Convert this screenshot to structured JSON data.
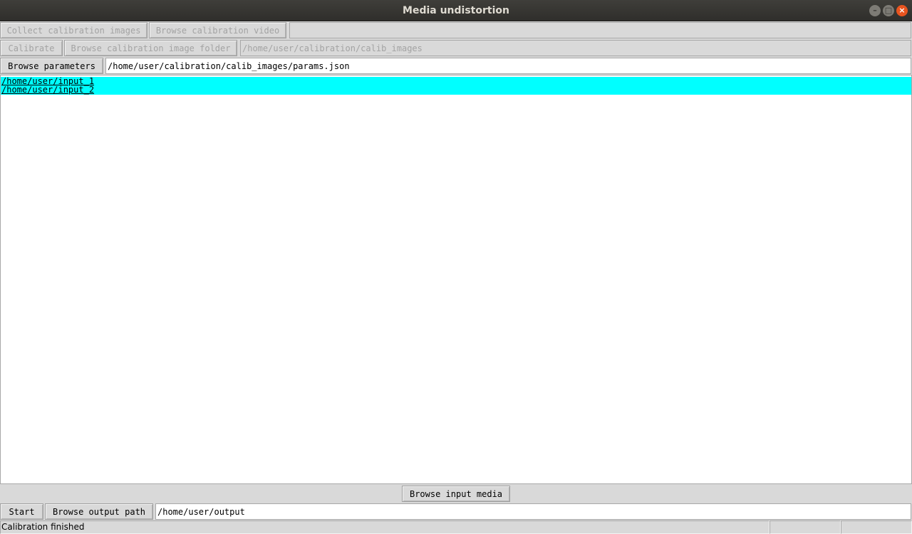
{
  "window": {
    "title": "Media undistortion",
    "minimize_glyph": "–",
    "maximize_glyph": "□",
    "close_glyph": "×"
  },
  "calibration": {
    "collect_images_label": "Collect calibration images",
    "browse_video_label": "Browse calibration video",
    "video_path_value": "",
    "calibrate_label": "Calibrate",
    "browse_image_folder_label": "Browse calibration image folder",
    "image_folder_value": "/home/user/calibration/calib_images"
  },
  "parameters": {
    "browse_label": "Browse parameters",
    "path_value": "/home/user/calibration/calib_images/params.json"
  },
  "input_media": {
    "items": [
      "/home/user/input_1",
      "/home/user/input_2"
    ],
    "browse_label": "Browse input media"
  },
  "output": {
    "start_label": "Start",
    "browse_label": "Browse output path",
    "path_value": "/home/user/output"
  },
  "status": {
    "message": "Calibration finished",
    "cell2": "",
    "cell3": ""
  },
  "colors": {
    "selection": "#00ffff",
    "window_bg": "#d9d9d9",
    "titlebar": "#3c3b37",
    "close_button": "#e9541f"
  }
}
